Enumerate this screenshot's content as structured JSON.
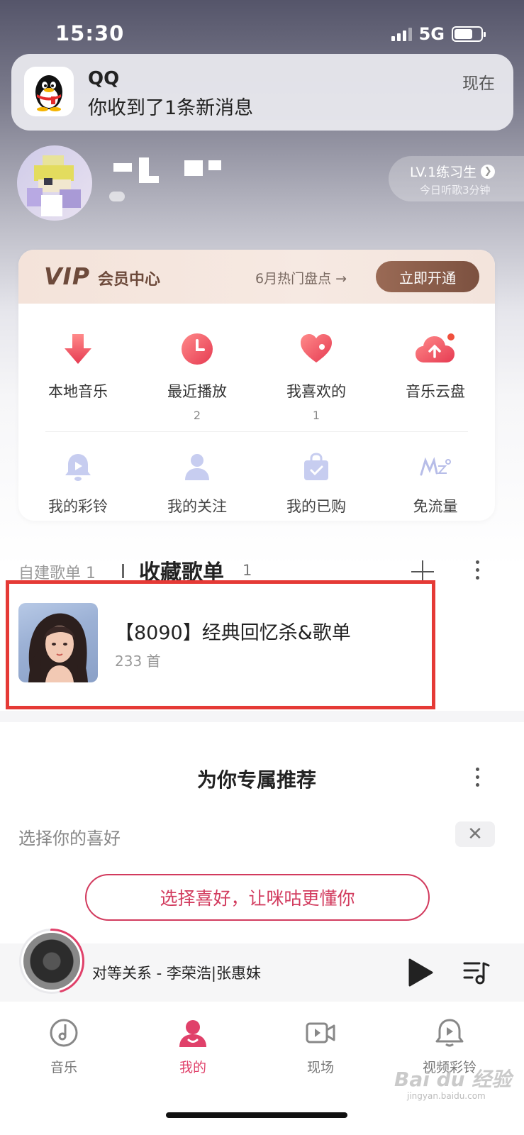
{
  "status_bar": {
    "time": "15:30",
    "network": "5G"
  },
  "notification": {
    "app": "QQ",
    "message": "你收到了1条新消息",
    "time": "现在"
  },
  "profile": {
    "level": "LV.1练习生",
    "listen_today": "今日听歌3分钟"
  },
  "vip": {
    "logo": "VIP",
    "title": "会员中心",
    "promo": "6月热门盘点 →",
    "button": "立即开通"
  },
  "quick_grid": [
    {
      "label": "本地音乐",
      "count": "",
      "icon": "download-arrow-icon"
    },
    {
      "label": "最近播放",
      "count": "2",
      "icon": "clock-icon"
    },
    {
      "label": "我喜欢的",
      "count": "1",
      "icon": "heart-icon"
    },
    {
      "label": "音乐云盘",
      "count": "",
      "icon": "cloud-upload-icon"
    }
  ],
  "quick_grid_small": [
    {
      "label": "我的彩铃",
      "icon": "bell-icon"
    },
    {
      "label": "我的关注",
      "icon": "person-icon"
    },
    {
      "label": "我的已购",
      "icon": "bag-icon"
    },
    {
      "label": "免流量",
      "icon": "mzone-icon"
    }
  ],
  "playlists": {
    "tab_self": "自建歌单 1",
    "tab_fav": "收藏歌单",
    "tab_fav_count": "1",
    "item": {
      "title": "【8090】经典回忆杀&歌单",
      "count": "233 首"
    }
  },
  "recommend": {
    "title": "为你专属推荐",
    "pref_label": "选择你的喜好",
    "pref_button": "选择喜好，让咪咕更懂你",
    "close_symbol": "✕"
  },
  "player": {
    "song": "对等关系 - 李荣浩|张惠妹"
  },
  "tabs": [
    {
      "label": "音乐",
      "icon": "music-disc-icon",
      "active": false
    },
    {
      "label": "我的",
      "icon": "user-icon",
      "active": true
    },
    {
      "label": "现场",
      "icon": "video-icon",
      "active": false
    },
    {
      "label": "视频彩铃",
      "icon": "bell-ring-icon",
      "active": false
    }
  ],
  "watermark": {
    "brand": "Bai du 经验",
    "url": "jingyan.baidu.com"
  },
  "colors": {
    "accent": "#e0416a",
    "vip_brown": "#7c5140",
    "highlight_red": "#e53a36"
  }
}
